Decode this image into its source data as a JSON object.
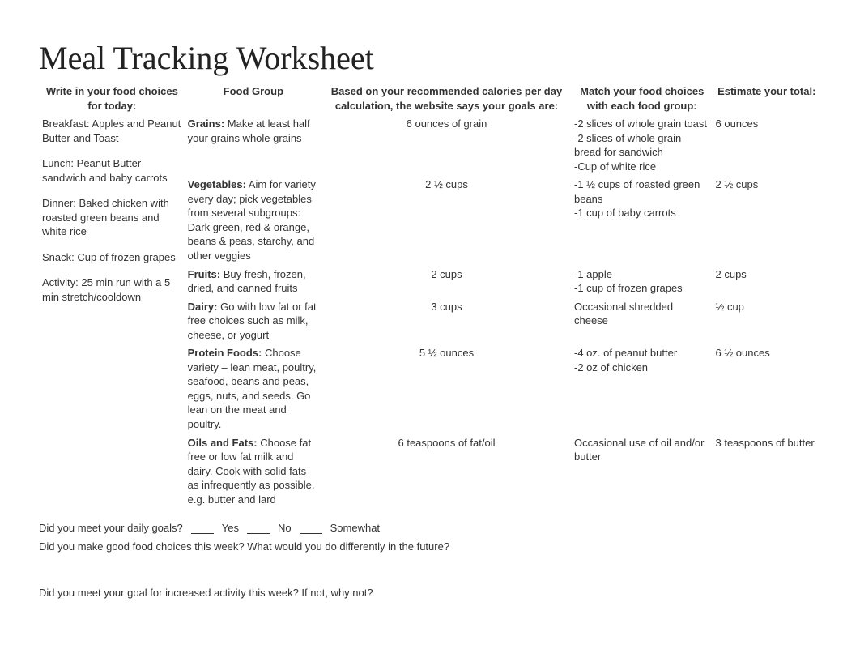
{
  "title": "Meal Tracking Worksheet",
  "headers": {
    "c1": "Write in your food choices for today:",
    "c2": "Food Group",
    "c3": "Based on your recommended calories per day calculation, the website says your goals are:",
    "c4": "Match your food choices with each food group:",
    "c5": "Estimate your total:"
  },
  "food_choices": {
    "breakfast": " Breakfast: Apples and Peanut Butter and Toast",
    "lunch": "Lunch: Peanut Butter sandwich and baby carrots",
    "dinner": "Dinner: Baked chicken with roasted green beans and white rice",
    "snack": "Snack: Cup of frozen grapes",
    "activity": "Activity: 25 min run with a 5 min stretch/cooldown"
  },
  "rows": [
    {
      "group_label": "Grains:",
      "group_desc": " Make at least half your grains whole grains",
      "goal": "6 ounces of grain",
      "match": "-2 slices of whole grain toast\n-2 slices of whole grain bread for sandwich\n-Cup of white rice",
      "total": "6 ounces"
    },
    {
      "group_label": "Vegetables:",
      "group_desc": " Aim for variety every day; pick vegetables from several subgroups: Dark green, red & orange, beans & peas, starchy, and other veggies",
      "goal": "2 ½ cups",
      "match": "-1 ½ cups of roasted green beans\n-1 cup of baby carrots",
      "total": "2 ½ cups"
    },
    {
      "group_label": "Fruits:",
      "group_desc": " Buy fresh, frozen, dried, and canned fruits",
      "goal": "2 cups",
      "match": "-1 apple\n-1 cup of frozen grapes",
      "total": "2 cups"
    },
    {
      "group_label": "Dairy:",
      "group_desc": " Go with low fat or fat free choices such as milk, cheese, or yogurt",
      "goal": "3 cups",
      "match": "Occasional shredded cheese",
      "total": "½ cup"
    },
    {
      "group_label": "Protein Foods:",
      "group_desc": " Choose variety – lean meat, poultry, seafood, beans and peas, eggs, nuts, and seeds. Go lean on the meat and poultry.",
      "goal": "5 ½ ounces",
      "match": "-4 oz. of peanut butter\n-2 oz of chicken",
      "total": "6 ½ ounces"
    },
    {
      "group_label": "Oils and Fats:",
      "group_desc": " Choose fat free or low fat milk and dairy. Cook with solid fats as infrequently as possible, e.g. butter and lard",
      "goal": "6 teaspoons of fat/oil",
      "match": "Occasional use of oil and/or butter",
      "total": "3 teaspoons of butter"
    }
  ],
  "footer": {
    "met_goals": {
      "q": "Did you meet your daily goals?",
      "opt1": "Yes",
      "opt2": "No",
      "opt3": "Somewhat"
    },
    "diet_comment_q": "Did you make good food choices this week? What would you do differently in the future?",
    "activity_comment_q": "Did you meet your goal for increased activity this week? If not, why not?"
  }
}
